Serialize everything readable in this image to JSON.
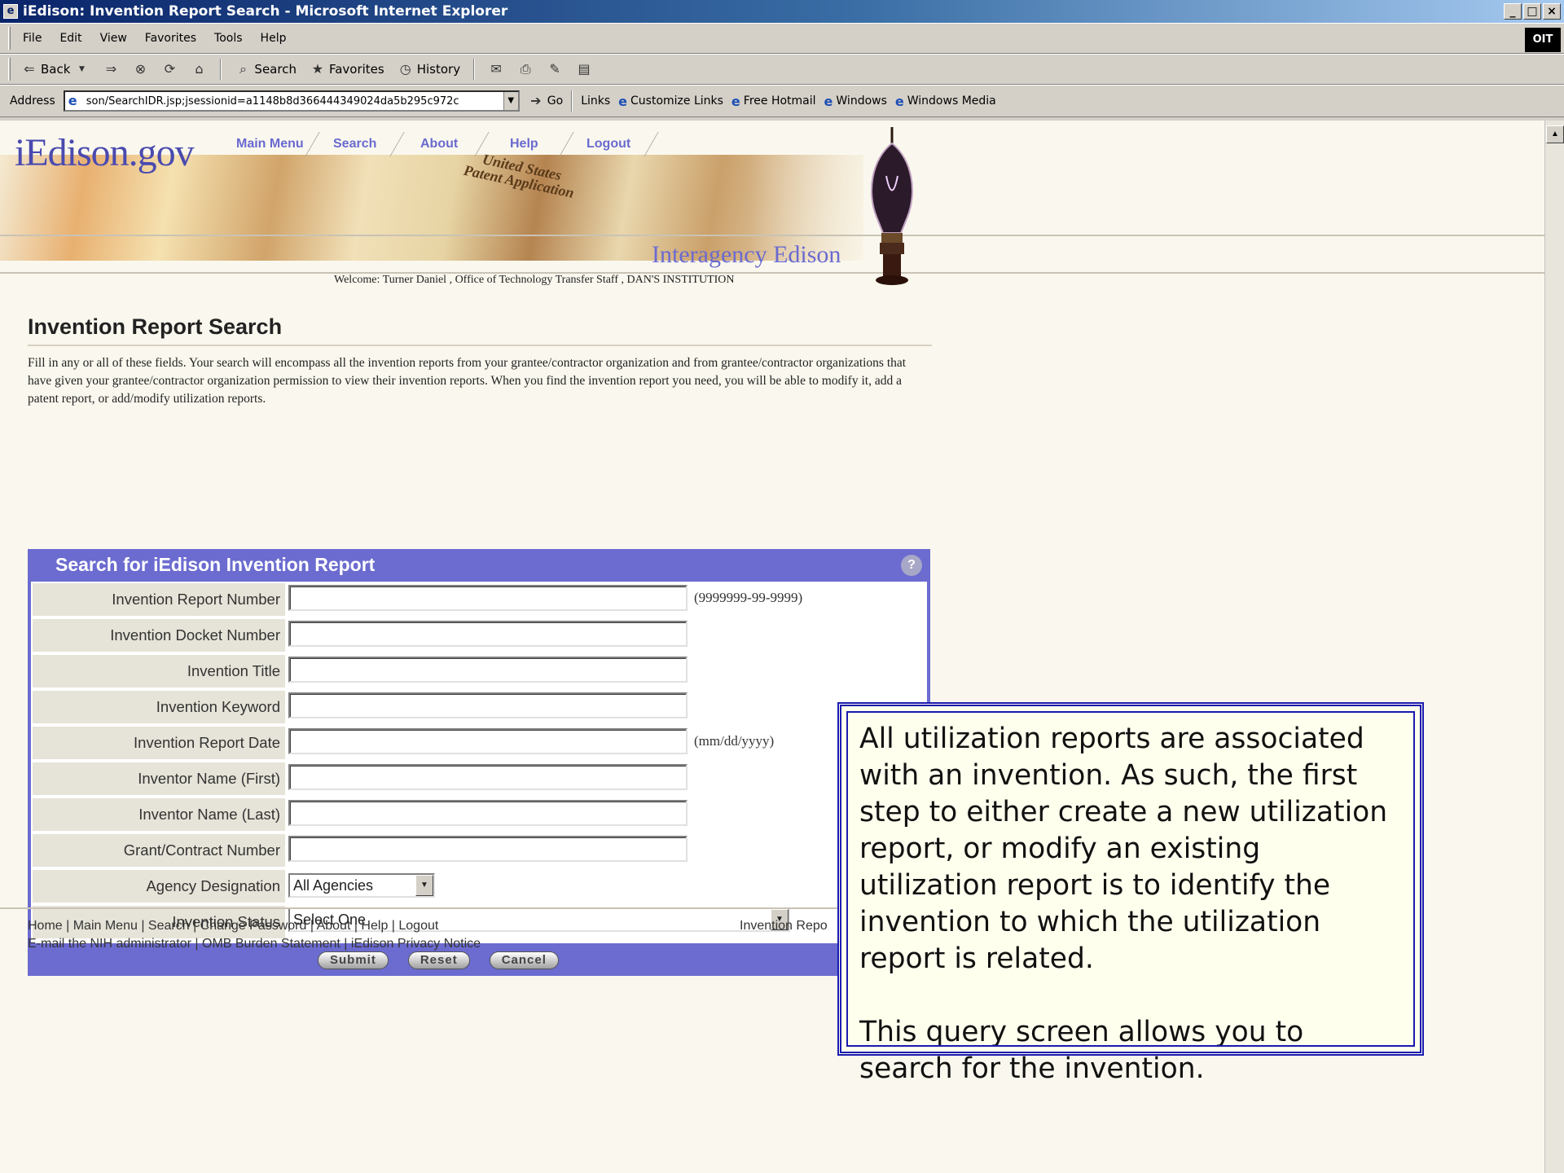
{
  "window": {
    "title": "iEdison: Invention Report Search - Microsoft Internet Explorer",
    "controls": [
      "_",
      "□",
      "×"
    ]
  },
  "menubar": {
    "items": [
      "File",
      "Edit",
      "View",
      "Favorites",
      "Tools",
      "Help"
    ],
    "badge": "OIT"
  },
  "toolbar": {
    "back": "Back",
    "search": "Search",
    "favorites": "Favorites",
    "history": "History"
  },
  "addressbar": {
    "label": "Address",
    "url": "son/SearchIDR.jsp;jsessionid=a1148b8d366444349024da5b295c972c",
    "go": "Go",
    "links_label": "Links",
    "links": [
      "Customize Links",
      "Free Hotmail",
      "Windows",
      "Windows Media"
    ]
  },
  "banner": {
    "logo": "iEdison.gov",
    "nav": [
      "Main Menu",
      "Search",
      "About",
      "Help",
      "Logout"
    ],
    "stamp_line1": "United States",
    "stamp_line2": "Patent Application",
    "subtitle": "Interagency Edison",
    "welcome": "Welcome: Turner Daniel , Office of Technology Transfer Staff , DAN'S INSTITUTION"
  },
  "main": {
    "title": "Invention Report Search",
    "intro": "Fill in any or all of these fields. Your search will encompass all the invention reports from your grantee/contractor organization and from grantee/contractor organizations that have given your grantee/contractor organization permission to view their invention reports. When you find the invention report you need, you will be able to modify it, add a patent report, or add/modify utilization reports."
  },
  "form": {
    "header": "Search for iEdison Invention Report",
    "help_icon": "?",
    "fields": [
      {
        "label": "Invention Report Number",
        "value": "",
        "hint": "(9999999-99-9999)"
      },
      {
        "label": "Invention Docket Number",
        "value": "",
        "hint": ""
      },
      {
        "label": "Invention Title",
        "value": "",
        "hint": ""
      },
      {
        "label": "Invention Keyword",
        "value": "",
        "hint": ""
      },
      {
        "label": "Invention Report Date",
        "value": "",
        "hint": "(mm/dd/yyyy)"
      },
      {
        "label": "Inventor Name (First)",
        "value": "",
        "hint": ""
      },
      {
        "label": "Inventor Name (Last)",
        "value": "",
        "hint": ""
      },
      {
        "label": "Grant/Contract Number",
        "value": "",
        "hint": ""
      }
    ],
    "agency": {
      "label": "Agency Designation",
      "selected": "All Agencies"
    },
    "status": {
      "label": "Invention Status",
      "selected": "Select One"
    },
    "buttons": {
      "submit": "Submit",
      "reset": "Reset",
      "cancel": "Cancel"
    }
  },
  "footer": {
    "line1": "Home | Main Menu | Search | Change Password | About | Help | Logout",
    "line2": "E-mail the NIH administrator | OMB Burden Statement | iEdison Privacy Notice",
    "right": "Invention Repo"
  },
  "callout": {
    "para1": "All utilization reports are associated with an invention.  As such, the first step to either create a new utilization report, or modify an existing utilization report is to identify the invention to which the utilization report is related.",
    "para2": "This query screen allows you to search for the invention."
  }
}
